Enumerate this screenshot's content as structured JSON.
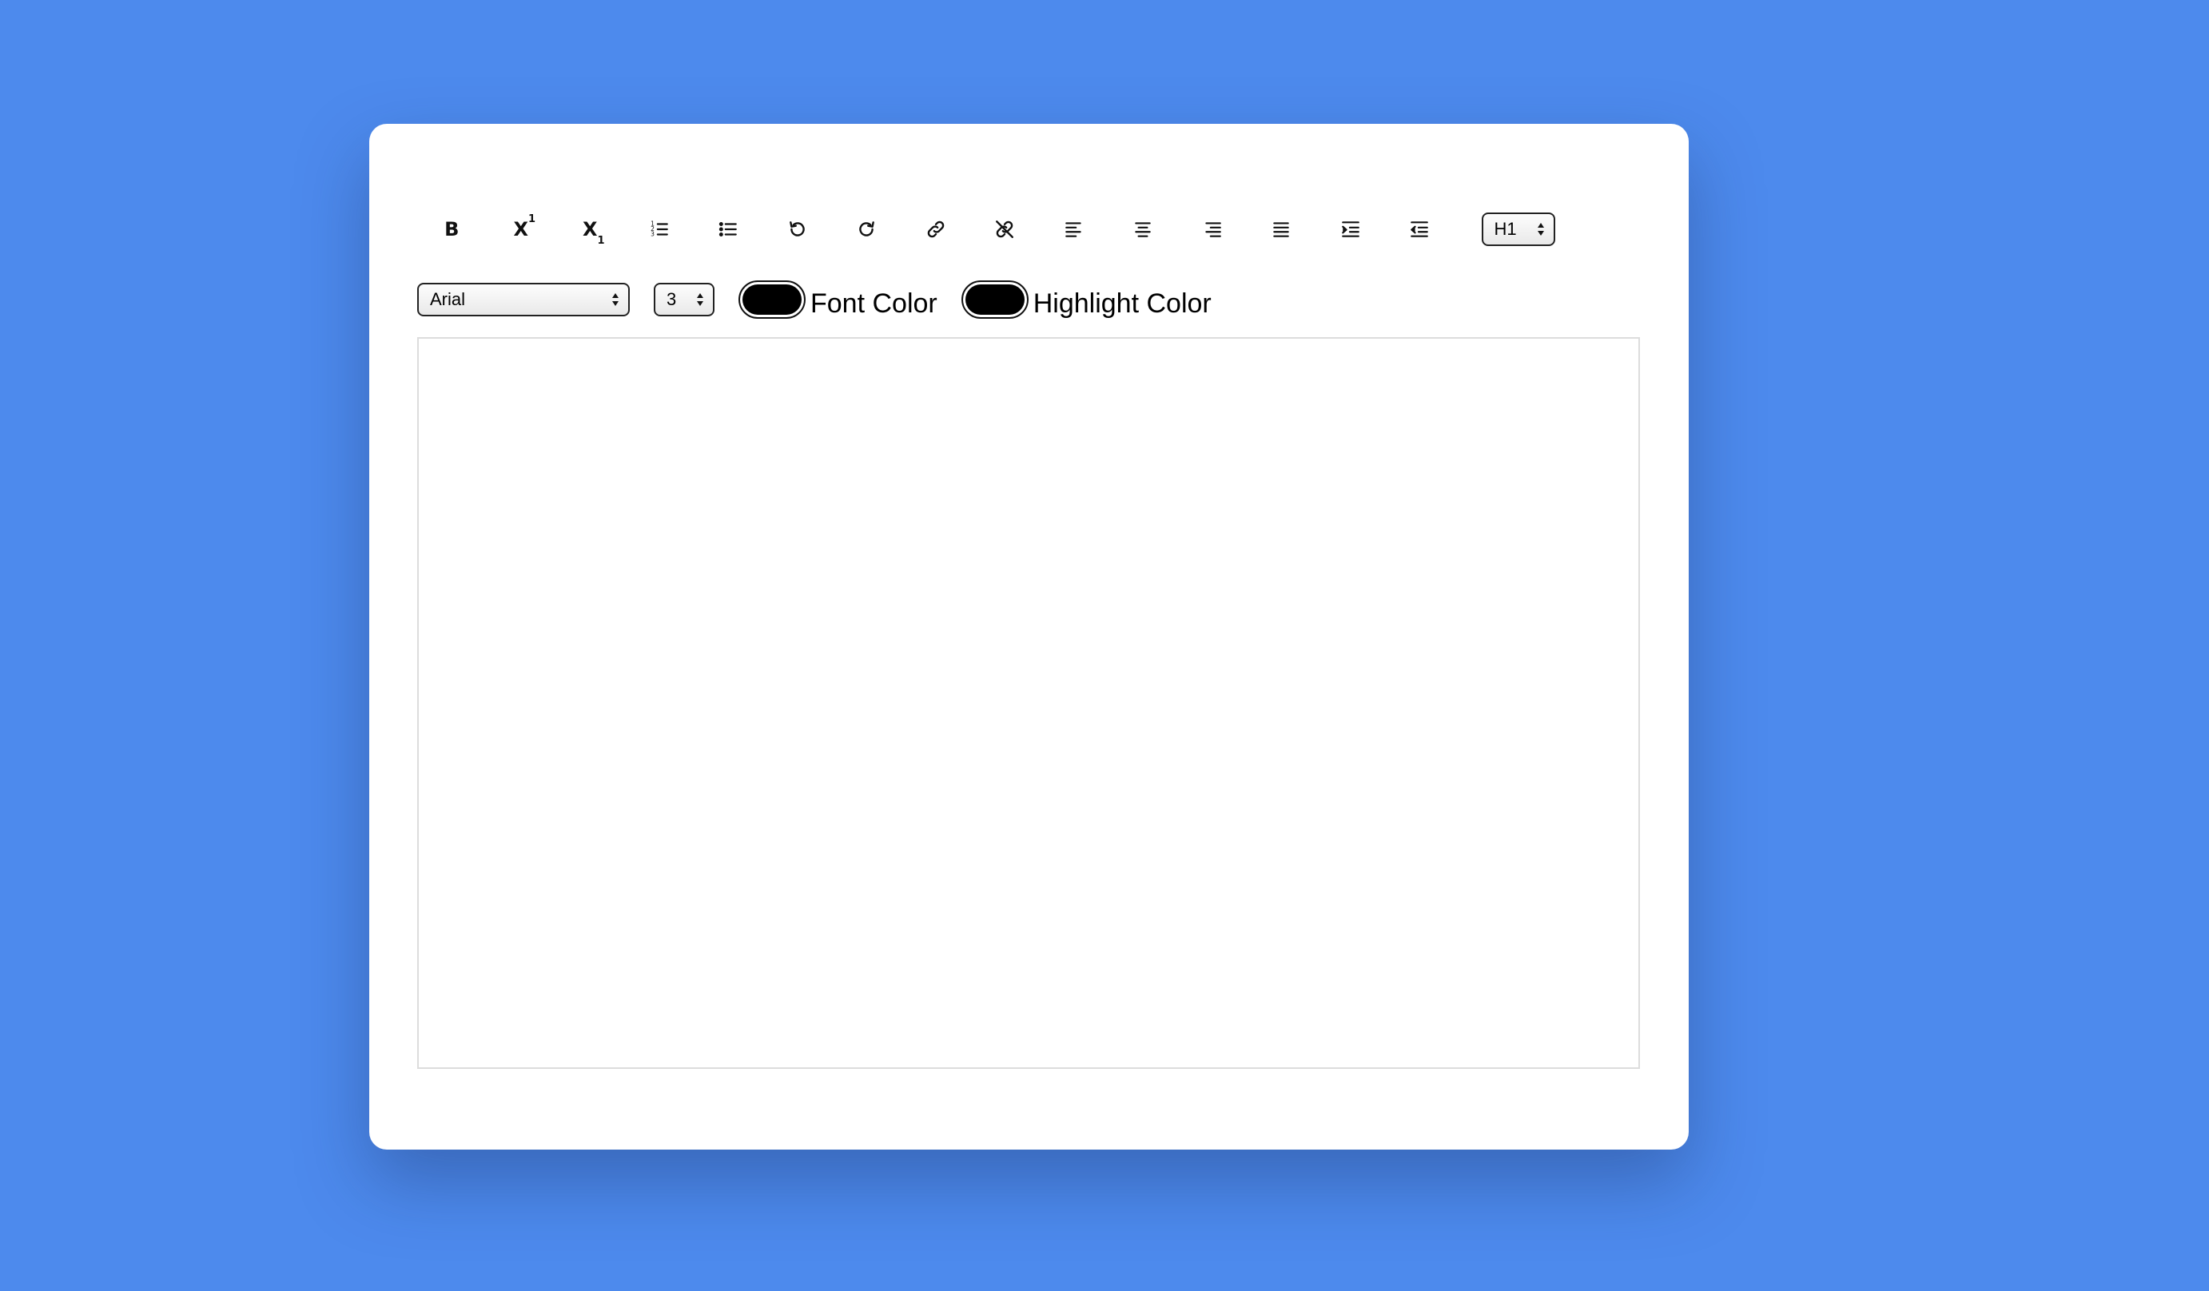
{
  "toolbar": {
    "buttons": [
      {
        "name": "bold",
        "icon": "bold-icon",
        "glyph": "B"
      },
      {
        "name": "superscript",
        "icon": "superscript-icon",
        "glyph": "X",
        "mark": "1"
      },
      {
        "name": "subscript",
        "icon": "subscript-icon",
        "glyph": "X",
        "mark": "1"
      },
      {
        "name": "ordered-list",
        "icon": "ordered-list-icon"
      },
      {
        "name": "unordered-list",
        "icon": "unordered-list-icon"
      },
      {
        "name": "undo",
        "icon": "undo-icon"
      },
      {
        "name": "redo",
        "icon": "redo-icon"
      },
      {
        "name": "link",
        "icon": "link-icon"
      },
      {
        "name": "unlink",
        "icon": "unlink-icon"
      },
      {
        "name": "align-left",
        "icon": "align-left-icon"
      },
      {
        "name": "align-center",
        "icon": "align-center-icon"
      },
      {
        "name": "align-right",
        "icon": "align-right-icon"
      },
      {
        "name": "justify",
        "icon": "align-justify-icon"
      },
      {
        "name": "indent",
        "icon": "indent-icon"
      },
      {
        "name": "outdent",
        "icon": "outdent-icon"
      }
    ],
    "heading_select": {
      "value": "H1"
    }
  },
  "format_row": {
    "font_select": {
      "value": "Arial"
    },
    "size_select": {
      "value": "3"
    },
    "font_color": {
      "label": "Font Color",
      "value": "#000000"
    },
    "highlight_color": {
      "label": "Highlight Color",
      "value": "#000000"
    }
  },
  "editor": {
    "content": ""
  },
  "colors": {
    "background": "#4d8aed",
    "card": "#ffffff",
    "editor_border": "#dcdcdc"
  }
}
